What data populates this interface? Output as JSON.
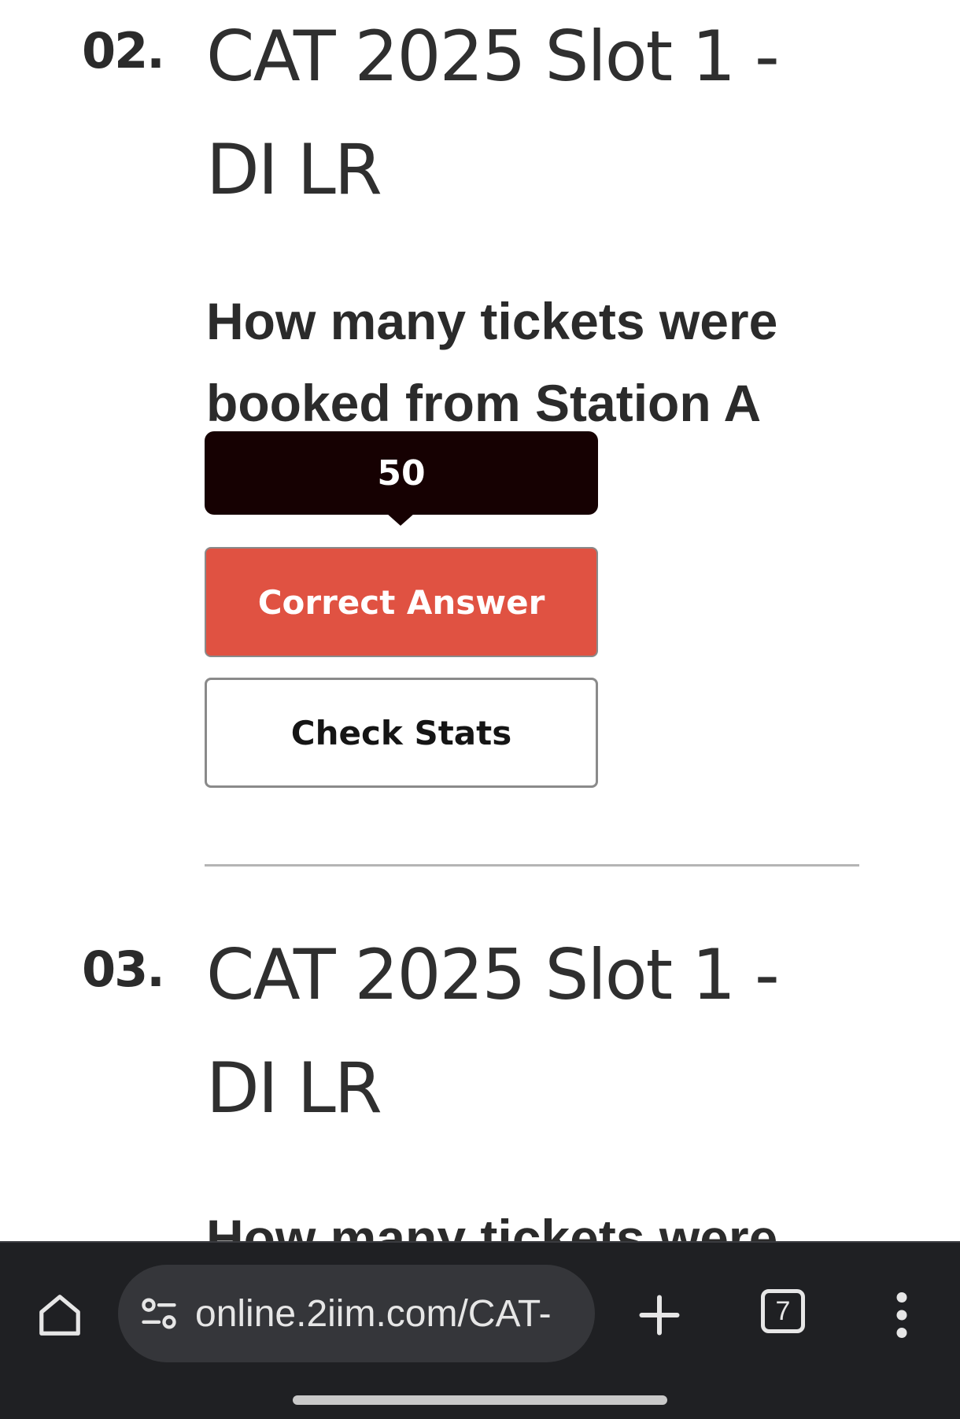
{
  "questions": [
    {
      "number": "02.",
      "title_line1": "CAT 2025 Slot 1 -",
      "title_line2": "DI LR",
      "text_line1": "How many tickets were",
      "text_line2": "booked from Station A"
    },
    {
      "number": "03.",
      "title_line1": "CAT 2025 Slot 1 -",
      "title_line2": "DI LR",
      "text_line1": "How many tickets were"
    }
  ],
  "answer_tooltip": "50",
  "buttons": {
    "correct_answer": "Correct Answer",
    "check_stats": "Check Stats"
  },
  "browser": {
    "url": "online.2iim.com/CAT-",
    "tab_count": "7",
    "icons": [
      "home-icon",
      "site-settings-icon",
      "plus-icon",
      "tab-switcher-icon",
      "more-vert-icon"
    ]
  },
  "colors": {
    "correct_button": "#e05242",
    "tooltip_bg": "#160102",
    "browser_bar": "#1f2023",
    "url_pill": "#35363a"
  }
}
